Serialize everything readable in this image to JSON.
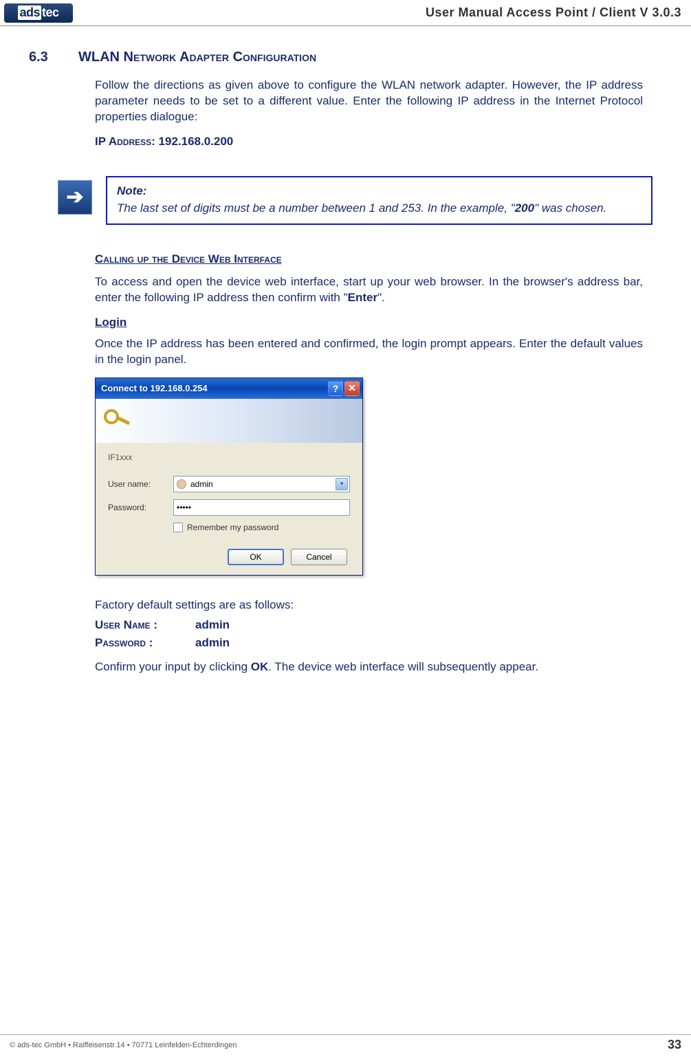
{
  "header": {
    "logo_text": "ads tec",
    "manual_title": "User Manual Access  Point / Client V 3.0.3"
  },
  "section": {
    "number": "6.3",
    "title": "WLAN Network Adapter Configuration"
  },
  "intro_paragraph": "Follow the directions as given above to configure the WLAN network adapter. However, the IP address parameter needs to be set to a different value. Enter the following IP address in the Internet Protocol properties dialogue:",
  "ip_address": {
    "label": "IP Address:",
    "value": "192.168.0.200"
  },
  "note": {
    "title": "Note:",
    "body_prefix": "The last set of digits must be a number between 1 and 253. In the example, \"",
    "body_bold": "200",
    "body_suffix": "\" was chosen."
  },
  "web_interface": {
    "heading": "Calling up the Device Web Interface",
    "paragraph_prefix": "To access and open the device web interface, start up your web browser. In the browser's address bar, enter the following IP address then confirm with \"",
    "paragraph_bold": "Enter",
    "paragraph_suffix": "\"."
  },
  "login": {
    "heading": "Login",
    "paragraph": "Once the IP address has been entered and confirmed, the login prompt appears. Enter the default values in the login panel."
  },
  "dialog": {
    "title": "Connect to 192.168.0.254",
    "realm": "IF1xxx",
    "username_label": "User name:",
    "username_value": "admin",
    "password_label": "Password:",
    "password_value": "•••••",
    "remember_label": "Remember my password",
    "ok_label": "OK",
    "cancel_label": "Cancel"
  },
  "defaults": {
    "intro": "Factory default settings are as follows:",
    "username_label": "User Name :",
    "username_value": "admin",
    "password_label": "Password :",
    "password_value": "admin",
    "confirm_prefix": "Confirm your input by clicking ",
    "confirm_bold": "OK",
    "confirm_suffix": ". The device web interface will subsequently appear."
  },
  "footer": {
    "copyright": "© ads-tec GmbH • Raiffeisenstr.14 • 70771 Leinfelden-Echterdingen",
    "page_number": "33"
  }
}
